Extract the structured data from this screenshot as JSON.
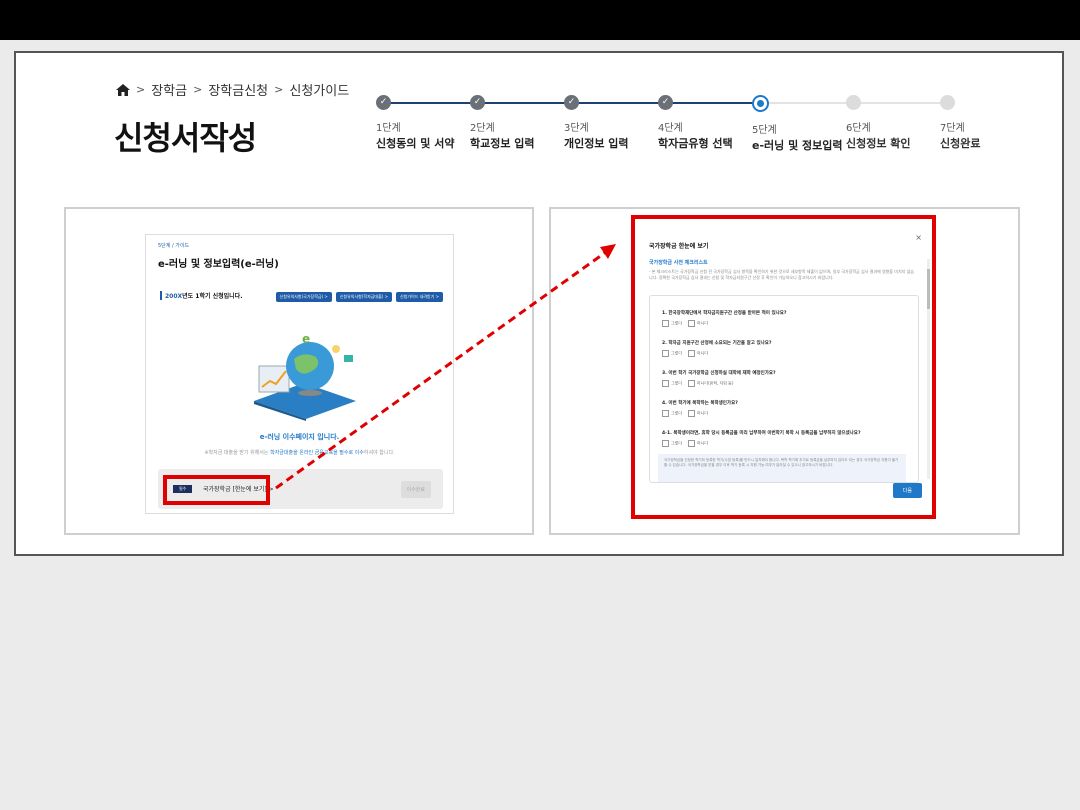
{
  "breadcrumb": {
    "home_icon": "home-icon",
    "items": [
      "장학금",
      "장학금신청",
      "신청가이드"
    ],
    "separator": ">"
  },
  "page_title": "신청서작성",
  "steps": [
    {
      "num": "1단계",
      "name": "신청동의 및 서약",
      "state": "done"
    },
    {
      "num": "2단계",
      "name": "학교정보 입력",
      "state": "done"
    },
    {
      "num": "3단계",
      "name": "개인정보 입력",
      "state": "done"
    },
    {
      "num": "4단계",
      "name": "학자금유형 선택",
      "state": "done"
    },
    {
      "num": "5단계",
      "name": "e-러닝 및 정보입력",
      "state": "current"
    },
    {
      "num": "6단계",
      "name": "신청정보 확인",
      "state": "todo"
    },
    {
      "num": "7단계",
      "name": "신청완료",
      "state": "todo"
    }
  ],
  "left_shot": {
    "breadcrumb": "5단계 / 가이드",
    "heading": "e-러닝 및 정보입력(e-러닝)",
    "semester_year": "200X",
    "semester_rest": "년도 1학기 신청입니다.",
    "buttons": [
      "신청유의사항(국가장학금) >",
      "신청유의사항(학자금대출) >",
      "신청가이드 내려받기 >"
    ],
    "elearning_title": "e-러닝 이수페이지 입니다.",
    "note_pre": "※학자금 대출을 받기 위해서는 ",
    "note_highlight": "학자금대출을 온라인 금융교육을 필수로 이수",
    "note_post": "하셔야 합니다.",
    "required_badge": "필수",
    "item_label": "국가장학금 [한눈에 보기] >",
    "done_button": "이수완료"
  },
  "modal": {
    "title": "국가장학금 한눈에 보기",
    "close": "×",
    "subtitle": "국가장학금 사전 체크리스트",
    "intro": "- 본 체크리스트는 국가장학금 신청 전 국가장학금 심사 항목을 확인하기 위한 것으로 세부항목 제출이 없으며, 일부 국가장학금 심사 결과에 영향을 미치지 않습니다. 정확한 국가장학금 심사 결과는 신청 및 학자금지원구간 산정 후 확인이 가능하오니 참고하시기 바랍니다.",
    "questions": [
      {
        "q": "1. 한국장학재단에서 학자금지원구간 산정을 받아본 적이 있나요?",
        "opts": [
          "그렇다",
          "아니다"
        ]
      },
      {
        "q": "2. 학자금 지원구간 산정에 소요되는 기간을 알고 있나요?",
        "opts": [
          "그렇다",
          "아니다"
        ]
      },
      {
        "q": "3. 이번 학기 국가장학금 신청하실 대학에 재학 예정인가요?",
        "opts": [
          "그렇다",
          "아니다(휴학, 자퇴 등)"
        ]
      },
      {
        "q": "4. 이번 학기에 복학하는 복학생인가요?",
        "opts": [
          "그렇다",
          "아니다"
        ]
      },
      {
        "q": "4-1. 복학생이라면, 휴학 당시 등록금을 미리 납부하여 이번학기 복학 시 등록금을 납부하지 않으셨나요?",
        "opts": [
          "그렇다",
          "아니다"
        ]
      }
    ],
    "note": "국가장학금을 신청한 학기와 등록한 학기(수업 등록)를 반드시 일치해야 합니다. 복학 학기에 추가로 등록금을 납부하지 않아도 되는 경우 국가장학금 지원이 불가할 수 있습니다. 국가장학금을 받을 경우 이후 학기 등록 시 지원 가능 여부가 달라질 수 있으니 참고하시기 바랍니다.",
    "next_button": "다음"
  },
  "colors": {
    "accent": "#1f78c8",
    "navy": "#1d3f74",
    "highlight": "#e00000"
  }
}
